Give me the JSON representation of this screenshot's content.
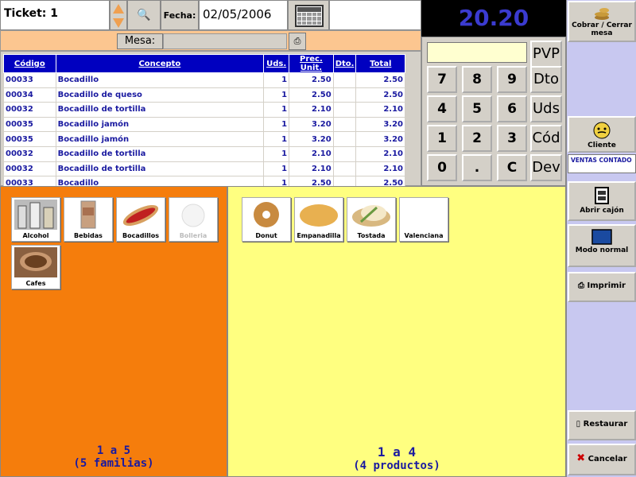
{
  "header": {
    "ticket_label": "Ticket: 1",
    "fecha_label": "Fecha:",
    "fecha_value": "02/05/2006",
    "total": "20.20"
  },
  "mesa": {
    "label": "Mesa:",
    "value": ""
  },
  "table": {
    "columns": [
      "Código",
      "Concepto",
      "Uds.",
      "Prec. Unit.",
      "Dto.",
      "Total"
    ],
    "rows": [
      [
        "00033",
        "Bocadillo",
        "1",
        "2.50",
        "",
        "2.50"
      ],
      [
        "00034",
        "Bocadillo de queso",
        "1",
        "2.50",
        "",
        "2.50"
      ],
      [
        "00032",
        "Bocadillo de tortilla",
        "1",
        "2.10",
        "",
        "2.10"
      ],
      [
        "00035",
        "Bocadillo jamón",
        "1",
        "3.20",
        "",
        "3.20"
      ],
      [
        "00035",
        "Bocadillo jamón",
        "1",
        "3.20",
        "",
        "3.20"
      ],
      [
        "00032",
        "Bocadillo de tortilla",
        "1",
        "2.10",
        "",
        "2.10"
      ],
      [
        "00032",
        "Bocadillo de tortilla",
        "1",
        "2.10",
        "",
        "2.10"
      ],
      [
        "00033",
        "Bocadillo",
        "1",
        "2.50",
        "",
        "2.50"
      ]
    ]
  },
  "keypad": {
    "input_value": "",
    "keys": [
      "7",
      "8",
      "9",
      "4",
      "5",
      "6",
      "1",
      "2",
      "3",
      "0",
      ".",
      "C"
    ],
    "function_keys": [
      "PVP",
      "Dto",
      "Uds",
      "Cód",
      "Dev"
    ]
  },
  "sidebar": {
    "cobrar": "Cobrar / Cerrar mesa",
    "cliente": "Cliente",
    "ventas": "VENTAS CONTADO",
    "abrir_cajon": "Abrir cajón",
    "modo": "Modo normal",
    "imprimir": "Imprimir",
    "restaurar": "Restaurar",
    "cancelar": "Cancelar"
  },
  "families": {
    "items": [
      {
        "label": "Alcohol",
        "enabled": true
      },
      {
        "label": "Bebidas",
        "enabled": true
      },
      {
        "label": "Bocadillos",
        "enabled": true
      },
      {
        "label": "Bolleria",
        "enabled": false
      },
      {
        "label": "Cafes",
        "enabled": true
      }
    ],
    "pager_range": "1 a 5",
    "pager_count": "(5 familias)"
  },
  "products": {
    "items": [
      {
        "label": "Donut"
      },
      {
        "label": "Empanadilla"
      },
      {
        "label": "Tostada"
      },
      {
        "label": "Valenciana"
      }
    ],
    "pager_range": "1 a 4",
    "pager_count": "(4 productos)"
  },
  "colors": {
    "families_bg": "#f57d0c",
    "products_bg": "#ffff80",
    "sidebar_bg": "#c8c8f0",
    "total_fg": "#3b3bd0",
    "table_header_bg": "#0000c0"
  }
}
